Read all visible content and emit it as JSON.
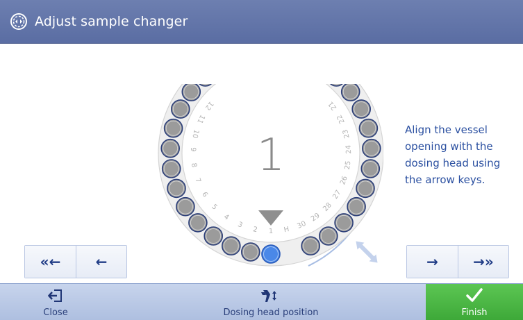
{
  "header": {
    "title": "Adjust sample changer",
    "icon": "rotate-circle-icon"
  },
  "main": {
    "current_position": "1",
    "instruction": "Align the vessel opening with the dosing head using the arrow keys.",
    "left_buttons": [
      {
        "label": "«←",
        "name": "fast-back-icon"
      },
      {
        "label": "←",
        "name": "back-icon"
      }
    ],
    "right_buttons": [
      {
        "label": "→",
        "name": "forward-icon"
      },
      {
        "label": "→»",
        "name": "fast-forward-icon"
      }
    ],
    "rack_labels": [
      "1",
      "2",
      "3",
      "4",
      "5",
      "6",
      "7",
      "8",
      "9",
      "10",
      "11",
      "12",
      "H",
      "30",
      "29",
      "28",
      "27",
      "26",
      "25",
      "24",
      "23",
      "22",
      "21"
    ],
    "colors": {
      "accent": "#5a6da3",
      "selected_vessel": "#4a88e8",
      "finish": "#3da838"
    }
  },
  "bottombar": {
    "close_label": "Close",
    "dosing_label": "Dosing head position",
    "finish_label": "Finish"
  }
}
